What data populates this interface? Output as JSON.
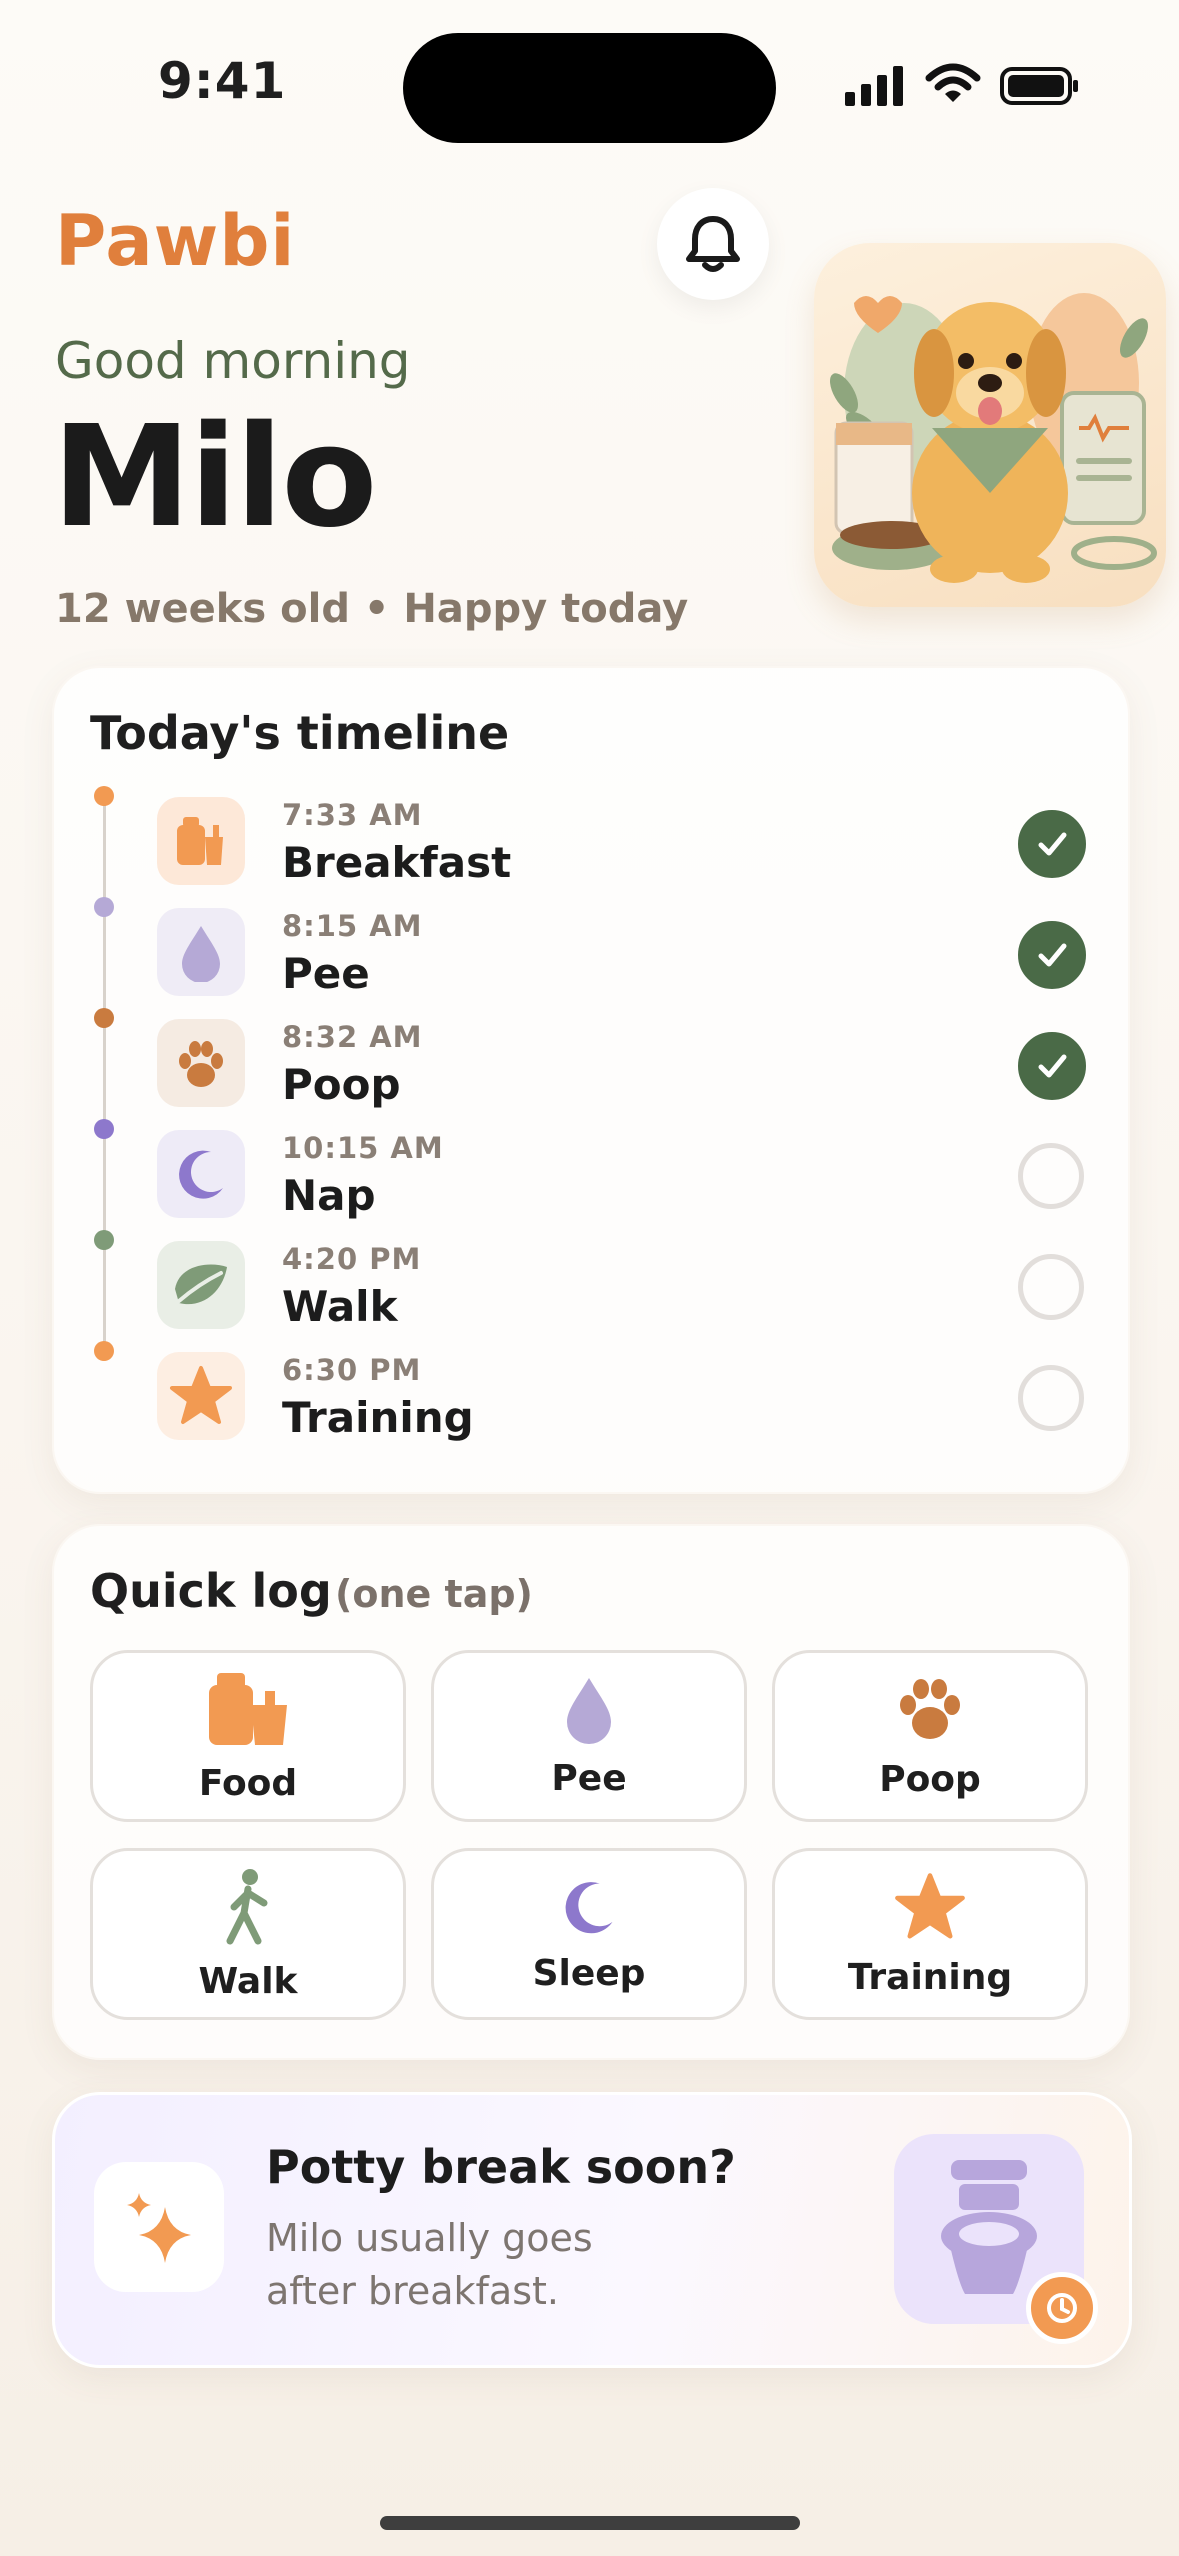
{
  "status_bar": {
    "time": "9:41"
  },
  "header": {
    "brand": "Pawbi",
    "greeting": "Good morning",
    "pet_name": "Milo",
    "subline": "12 weeks old • Happy today"
  },
  "timeline": {
    "title": "Today's timeline",
    "items": [
      {
        "time": "7:33 AM",
        "label": "Breakfast",
        "icon": "food-bag-icon",
        "done": true,
        "color": "#f29a52"
      },
      {
        "time": "8:15 AM",
        "label": "Pee",
        "icon": "droplet-icon",
        "done": true,
        "color": "#b5a9d6"
      },
      {
        "time": "8:32 AM",
        "label": "Poop",
        "icon": "paw-icon",
        "done": true,
        "color": "#c97b3f"
      },
      {
        "time": "10:15 AM",
        "label": "Nap",
        "icon": "moon-icon",
        "done": false,
        "color": "#8d78cc"
      },
      {
        "time": "4:20 PM",
        "label": "Walk",
        "icon": "leaf-icon",
        "done": false,
        "color": "#7f9b78"
      },
      {
        "time": "6:30 PM",
        "label": "Training",
        "icon": "star-icon",
        "done": false,
        "color": "#f29a52"
      }
    ]
  },
  "quick_log": {
    "title": "Quick log",
    "subtitle": "(one tap)",
    "buttons": [
      {
        "label": "Food",
        "icon": "food-bag-icon"
      },
      {
        "label": "Pee",
        "icon": "droplet-icon"
      },
      {
        "label": "Poop",
        "icon": "paw-icon"
      },
      {
        "label": "Walk",
        "icon": "walking-person-icon"
      },
      {
        "label": "Sleep",
        "icon": "moon-icon"
      },
      {
        "label": "Training",
        "icon": "star-icon"
      }
    ]
  },
  "potty": {
    "title": "Potty break soon?",
    "text": "Milo usually goes after breakfast."
  },
  "colors": {
    "brand": "#e07f3c",
    "greeting": "#546a4a",
    "check_done": "#4a6a47"
  }
}
